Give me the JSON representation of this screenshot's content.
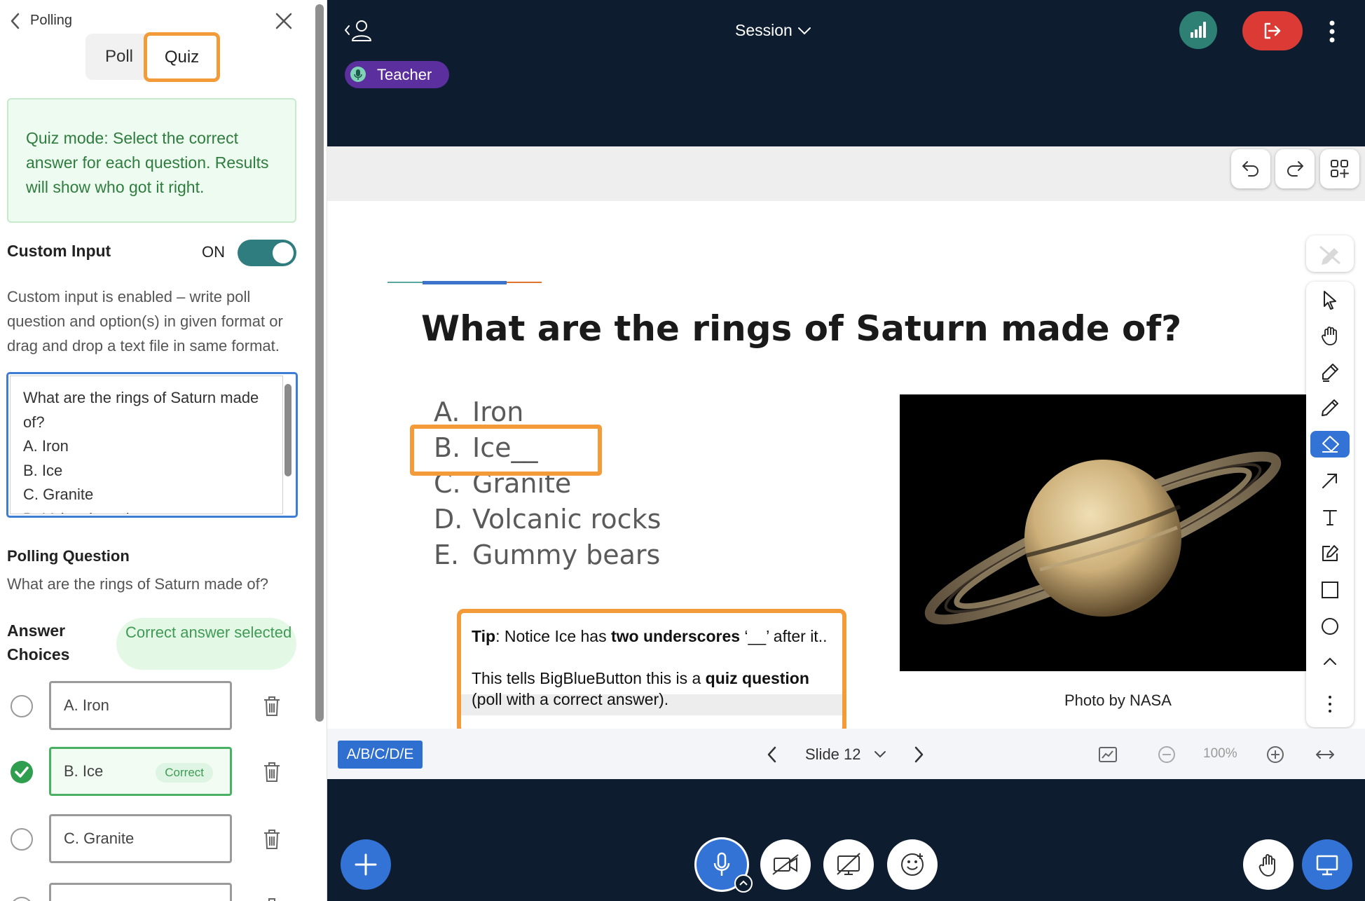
{
  "panel": {
    "title": "Polling",
    "tabs": {
      "poll": "Poll",
      "quiz": "Quiz",
      "active": "Quiz"
    },
    "quiz_info": "Quiz mode: Select the correct answer for each question. Results will show who got it right.",
    "custom_input": {
      "label": "Custom Input",
      "state_label": "ON",
      "enabled": true,
      "description": "Custom input is enabled – write poll question and option(s) in given format or drag and drop a text file in same format.",
      "textarea_lines": [
        "What are the rings of Saturn made",
        "of?",
        "A. Iron",
        "B. Ice",
        "C. Granite",
        "D. Volcanic rocks"
      ]
    },
    "polling_question": {
      "label": "Polling Question",
      "text": "What are the rings of Saturn made of?"
    },
    "answer_choices": {
      "label": "Answer Choices",
      "badge": "Correct answer selected",
      "items": [
        {
          "value": "A. Iron",
          "correct": false
        },
        {
          "value": "B. Ice",
          "correct": true,
          "tag": "Correct"
        },
        {
          "value": "C. Granite",
          "correct": false
        }
      ]
    }
  },
  "topbar": {
    "session_label": "Session",
    "teacher_label": "Teacher",
    "colors": {
      "background": "#0d1c2e",
      "connection": "#2e7f74",
      "leave": "#dc3b35",
      "teacher_pill": "#5b2f9d"
    }
  },
  "slide": {
    "title": "What are the rings of Saturn made of?",
    "options": [
      {
        "letter": "A.",
        "text": "Iron"
      },
      {
        "letter": "B.",
        "text": "Ice__"
      },
      {
        "letter": "C.",
        "text": "Granite"
      },
      {
        "letter": "D.",
        "text": "Volcanic rocks"
      },
      {
        "letter": "E.",
        "text": "Gummy bears"
      }
    ],
    "photo_credit": "Photo by NASA",
    "tip": {
      "label": "Tip",
      "text1": ": Notice Ice has ",
      "emph1": "two underscores",
      "text2": " ‘__’ after it..",
      "text3": "This tells BigBlueButton this is a ",
      "emph2": "quiz question",
      "text4": " (poll with a correct answer)."
    },
    "highlight_color": "#f39b38"
  },
  "footer": {
    "quick_poll_label": "A/B/C/D/E",
    "slide_label": "Slide 12",
    "zoom_label": "100%"
  },
  "tools": [
    "select-icon",
    "pan-hand-icon",
    "highlighter-icon",
    "pencil-icon",
    "eraser-icon",
    "arrow-icon",
    "text-icon",
    "note-icon",
    "rectangle-icon",
    "ellipse-icon",
    "chevron-up-icon",
    "more-icon"
  ],
  "active_tool": "eraser-icon"
}
